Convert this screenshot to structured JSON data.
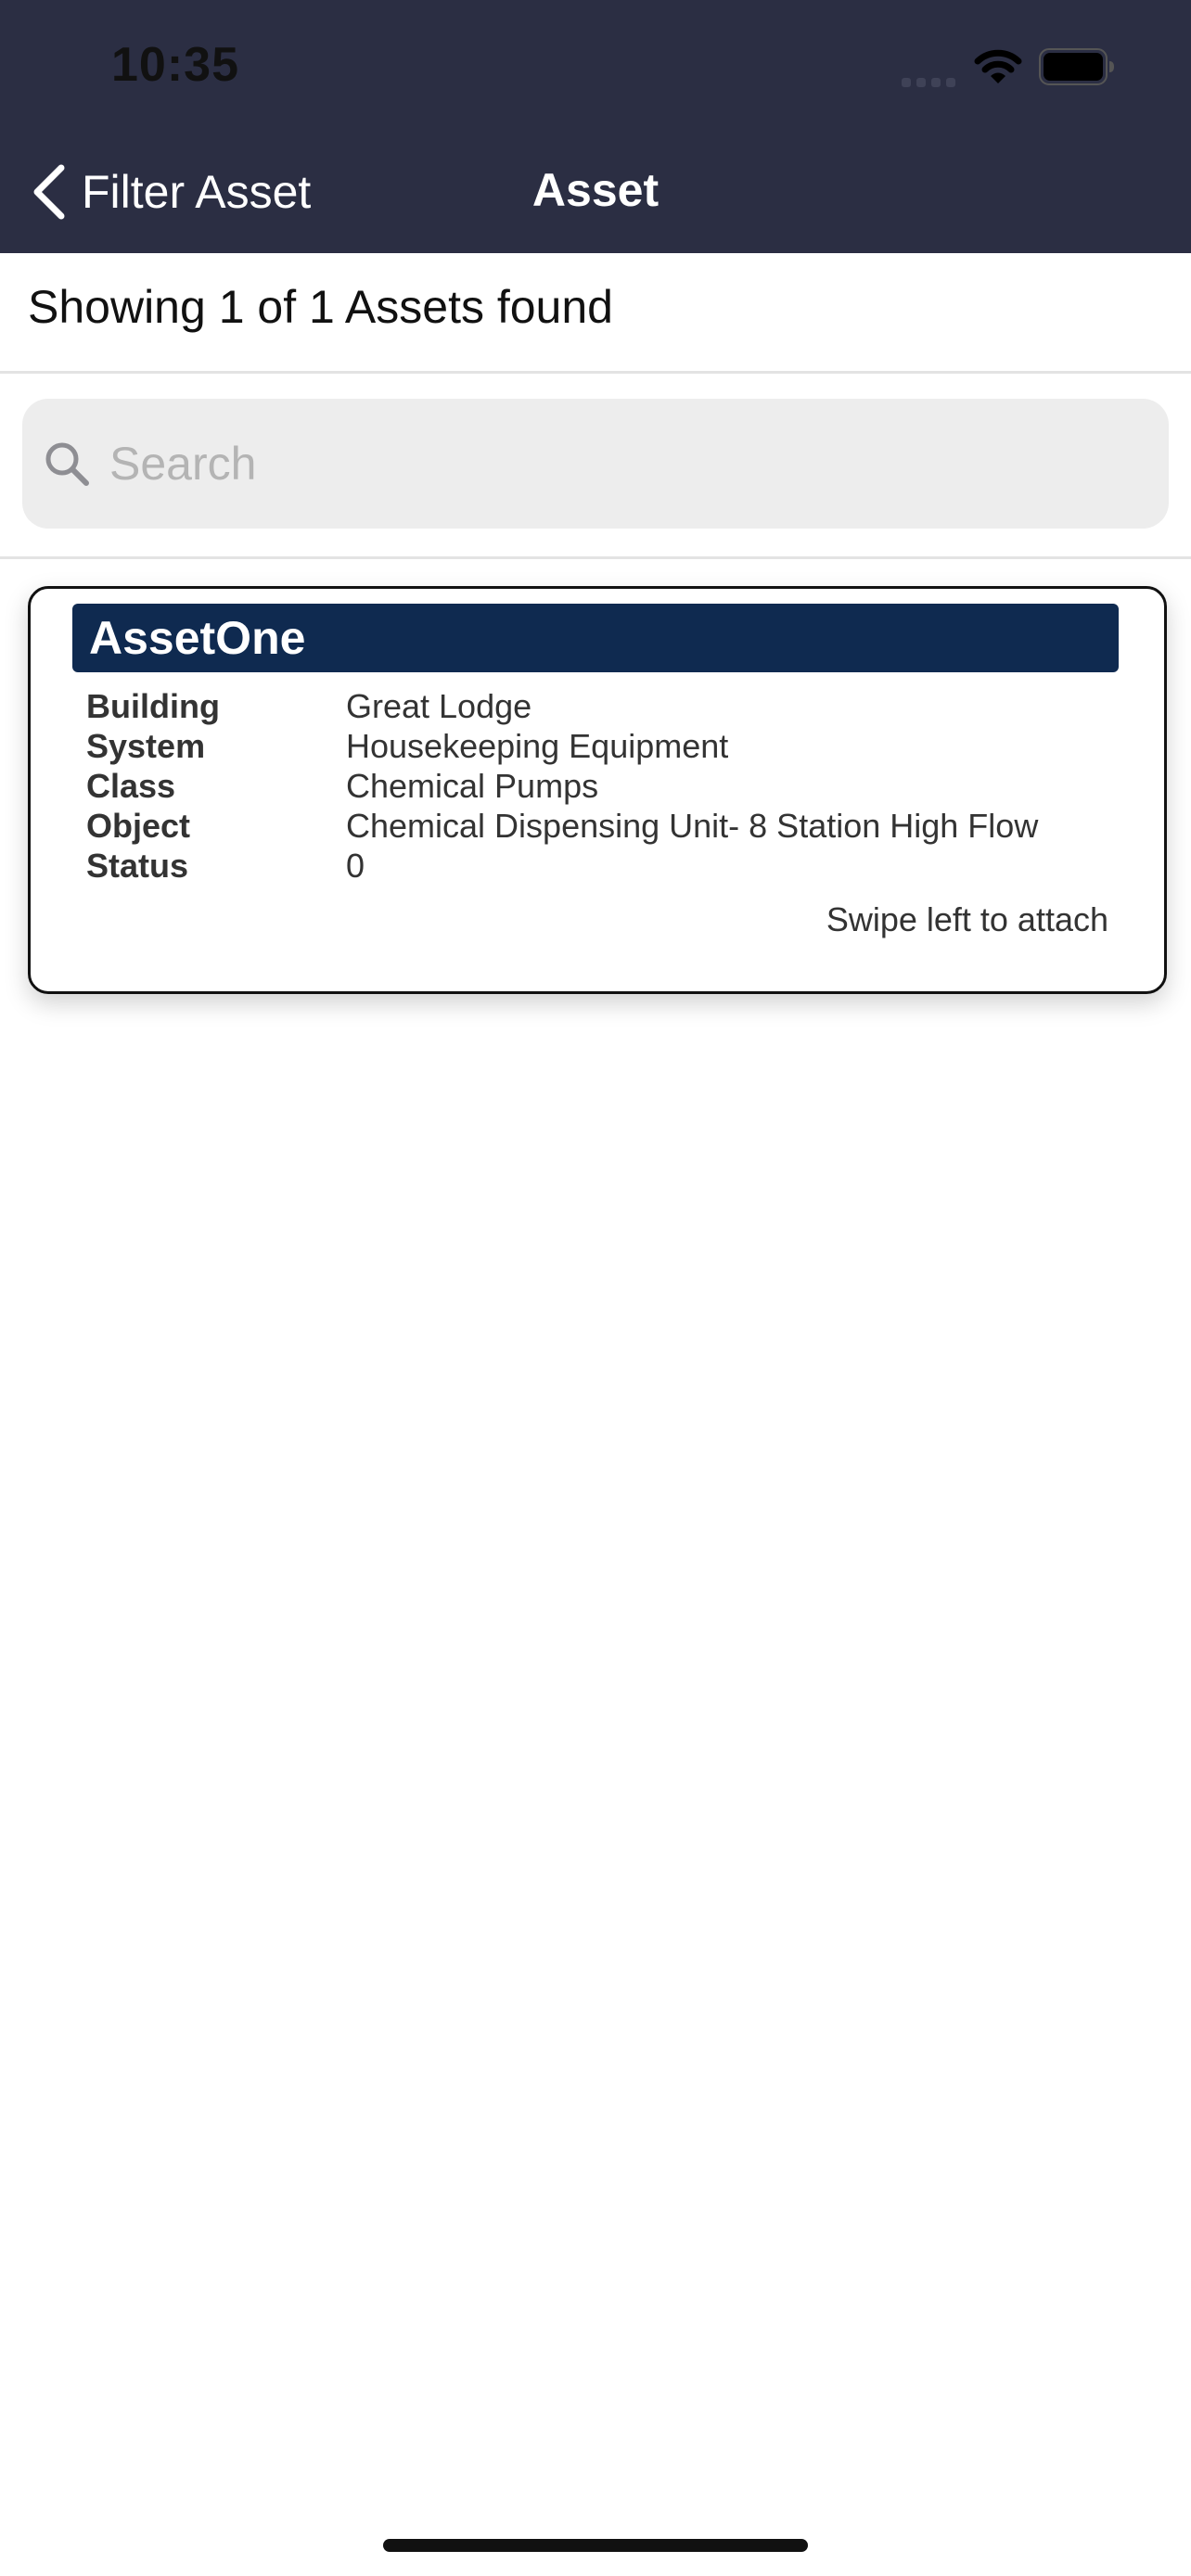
{
  "status_bar": {
    "time": "10:35"
  },
  "nav": {
    "back_label": "Filter Asset",
    "title": "Asset"
  },
  "results": {
    "summary": "Showing 1 of 1 Assets found"
  },
  "search": {
    "placeholder": "Search",
    "value": ""
  },
  "assets": [
    {
      "name": "AssetOne",
      "fields": [
        {
          "label": "Building",
          "value": "Great Lodge"
        },
        {
          "label": "System",
          "value": "Housekeeping Equipment"
        },
        {
          "label": "Class",
          "value": "Chemical Pumps"
        },
        {
          "label": "Object",
          "value": "Chemical Dispensing Unit- 8 Station High Flow"
        },
        {
          "label": "Status",
          "value": "0"
        }
      ],
      "hint": "Swipe left to attach"
    }
  ],
  "colors": {
    "nav_background": "#2b2e43",
    "asset_header": "#0f2a50",
    "search_background": "#ededed"
  }
}
